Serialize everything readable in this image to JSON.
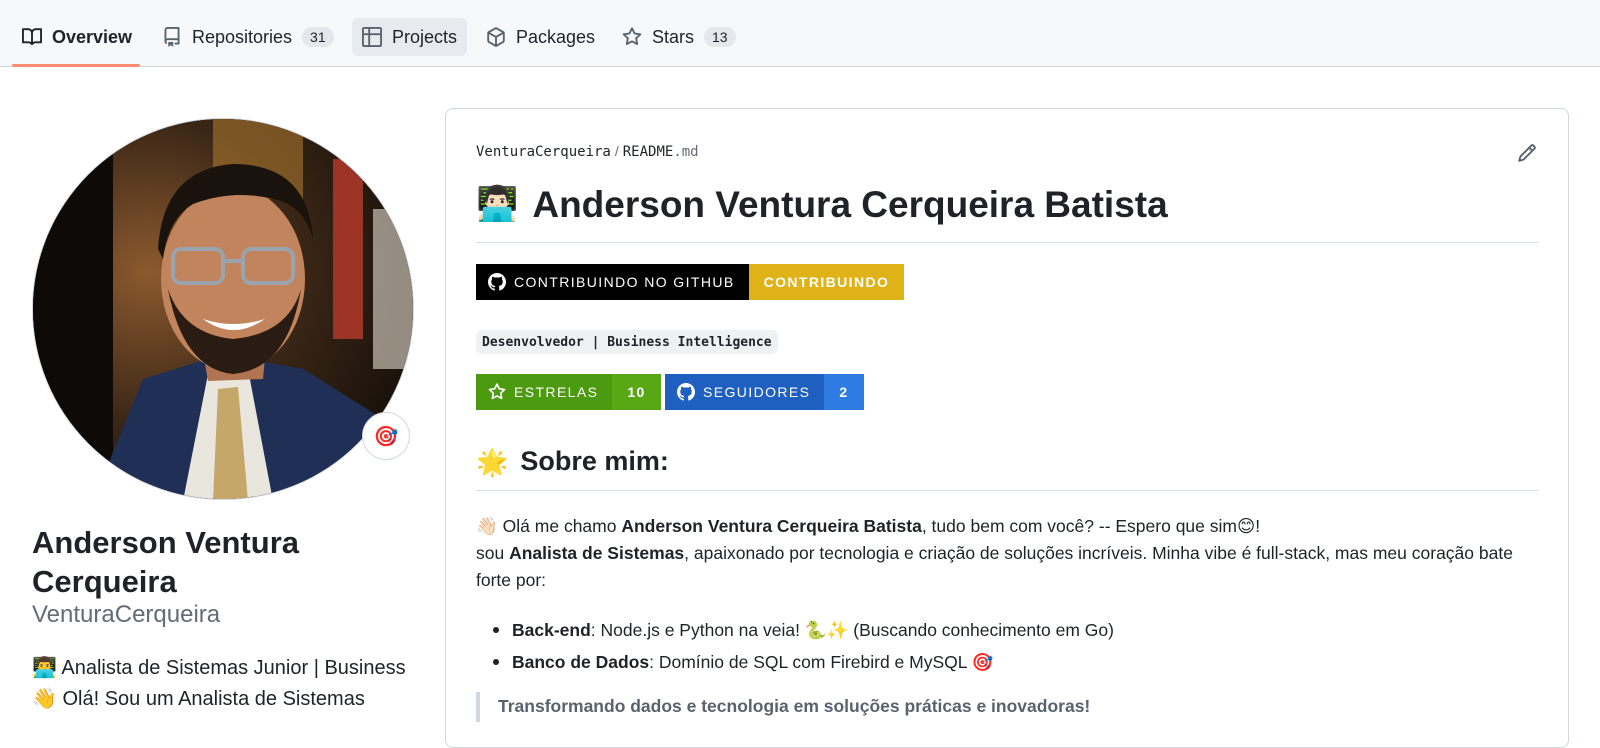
{
  "nav": {
    "tabs": [
      {
        "label": "Overview",
        "icon": "book-icon",
        "selected": true
      },
      {
        "label": "Repositories",
        "icon": "repo-icon",
        "count": "31"
      },
      {
        "label": "Projects",
        "icon": "table-icon"
      },
      {
        "label": "Packages",
        "icon": "package-icon"
      },
      {
        "label": "Stars",
        "icon": "star-icon",
        "count": "13"
      }
    ],
    "accent_color": "#fd8c73"
  },
  "profile": {
    "status_emoji": "🎯",
    "fullname": "Anderson Ventura Cerqueira",
    "username": "VenturaCerqueira",
    "bio_lines": [
      {
        "emoji": "👨‍💻",
        "text": "Analista de Sistemas Junior | Business"
      },
      {
        "emoji": "👋",
        "text": "Olá! Sou um Analista de Sistemas"
      }
    ]
  },
  "readme": {
    "path_user": "VenturaCerqueira",
    "path_sep": "/",
    "path_file": "README",
    "path_ext": ".md",
    "title_emoji": "👨🏻‍💻",
    "title": "Anderson Ventura Cerqueira Batista",
    "badge_contrib": {
      "left": "CONTRIBUINDO NO GITHUB",
      "right": "CONTRIBUINDO",
      "left_color": "#000000",
      "right_color": "#dfb317"
    },
    "code_badge": "Desenvolvedor | Business Intelligence",
    "badge_stars": {
      "left": "ESTRELAS",
      "right": "10",
      "color": "#4c9a0f"
    },
    "badge_followers": {
      "left": "SEGUIDORES",
      "right": "2",
      "left_color": "#1f5fbf",
      "right_color": "#2d7be3"
    },
    "about_emoji": "🌟",
    "about_title": "Sobre mim:",
    "intro": {
      "wave": "👋🏻",
      "p1_pre": "Olá me chamo ",
      "p1_name": "Anderson Ventura Cerqueira Batista",
      "p1_post": ", tudo bem com você? -- Espero que sim",
      "smile": "😊",
      "p1_end": "!",
      "p2_pre": "sou ",
      "p2_role": "Analista de Sistemas",
      "p2_post": ", apaixonado por tecnologia e criação de soluções incríveis. Minha vibe é full-stack, mas meu coração bate forte por:"
    },
    "bullets": [
      {
        "label": "Back-end",
        "text": ": Node.js e Python na veia! ",
        "emoji": "🐍✨",
        "tail": " (Buscando conhecimento em Go)"
      },
      {
        "label": "Banco de Dados",
        "text": ": Domínio de SQL com Firebird e MySQL ",
        "emoji": "🎯",
        "tail": ""
      }
    ],
    "quote": "Transformando dados e tecnologia em soluções práticas e inovadoras!"
  }
}
